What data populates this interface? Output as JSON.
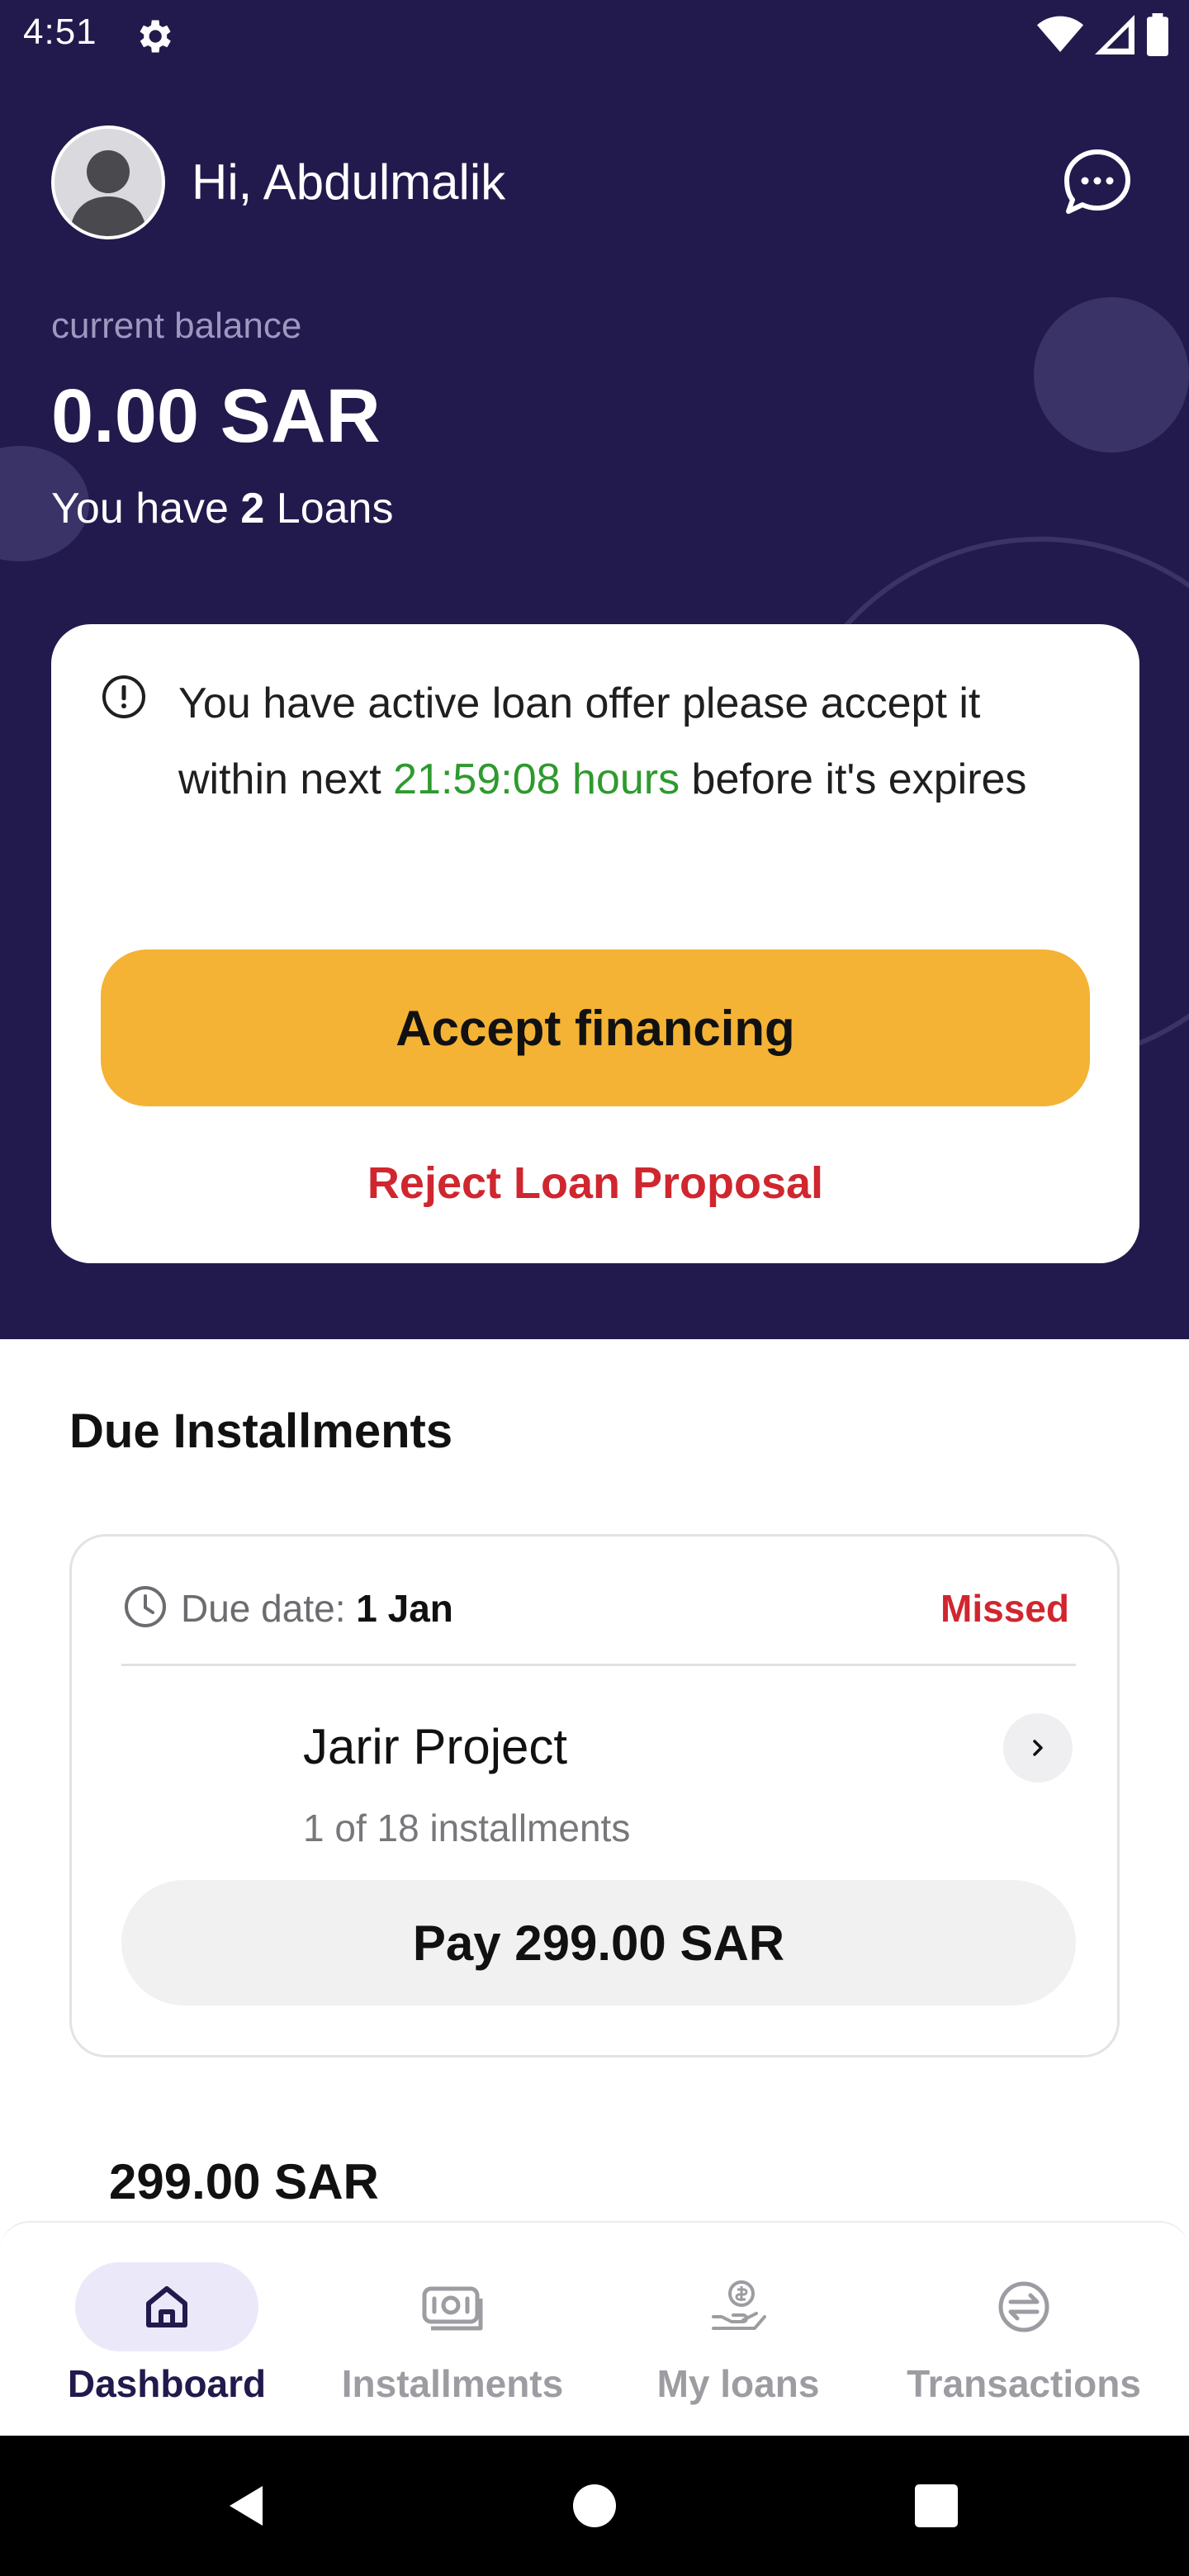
{
  "status_bar": {
    "time": "4:51",
    "icons": [
      "gear-icon",
      "wifi-icon",
      "signal-icon",
      "battery-icon"
    ]
  },
  "header": {
    "greeting": "Hi, Abdulmalik",
    "balance_label": "current balance",
    "balance_value": "0.00 SAR",
    "loans_prefix": "You have",
    "loans_count": "2",
    "loans_suffix": "Loans",
    "colors": {
      "background": "#221a4d",
      "decor": "#3a3367"
    }
  },
  "offer_card": {
    "message_prefix": "You have active loan offer please accept it within next",
    "timer": "21:59:08 hours",
    "message_suffix": "before it's expires",
    "accept_label": "Accept financing",
    "reject_label": "Reject Loan Proposal",
    "colors": {
      "accept": "#f4b335",
      "reject": "#d0262f",
      "timer": "#2e9a2e"
    }
  },
  "due_installments": {
    "title": "Due Installments",
    "items": [
      {
        "due_date_label": "Due date:",
        "due_date": "1 Jan",
        "status": "Missed",
        "project": "Jarir Project",
        "installments": "1 of 18 installments",
        "pay_label": "Pay 299.00 SAR"
      }
    ],
    "next_amount": "299.00 SAR"
  },
  "bottom_nav": {
    "items": [
      {
        "label": "Dashboard",
        "icon": "home-icon",
        "active": true
      },
      {
        "label": "Installments",
        "icon": "cash-icon",
        "active": false
      },
      {
        "label": "My loans",
        "icon": "hand-coin-icon",
        "active": false
      },
      {
        "label": "Transactions",
        "icon": "exchange-icon",
        "active": false
      }
    ]
  },
  "system_nav": [
    "back-icon",
    "home-circle-icon",
    "recents-icon"
  ]
}
